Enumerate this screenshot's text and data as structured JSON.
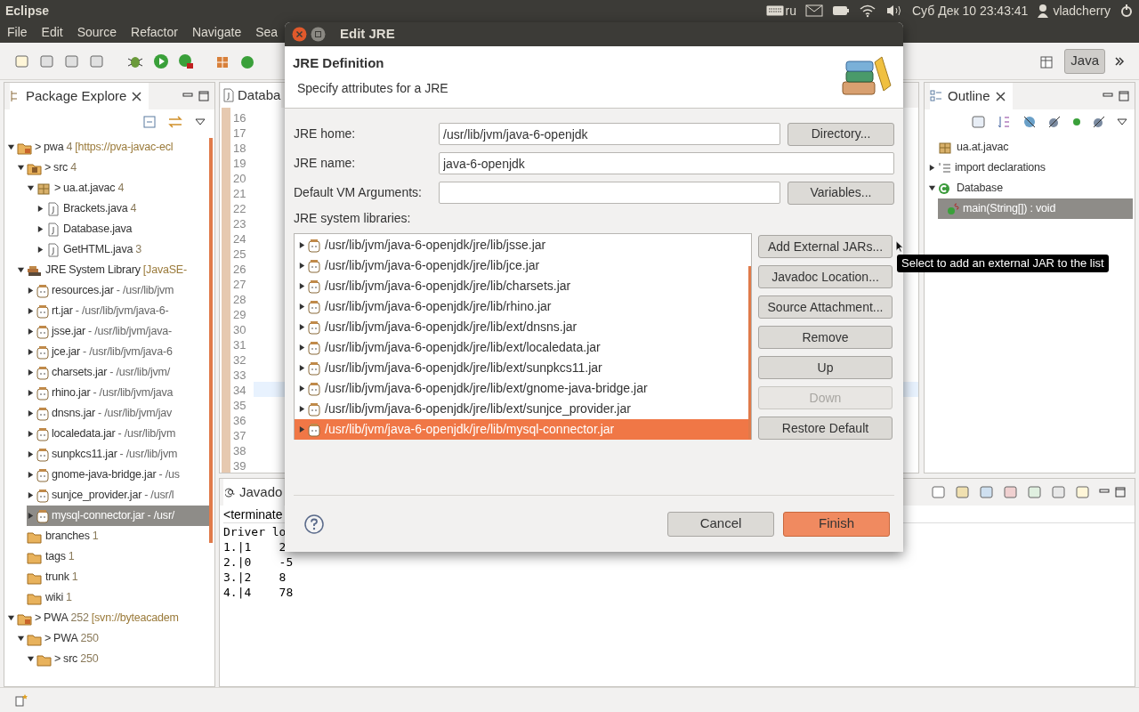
{
  "top_panel": {
    "app_title": "Eclipse",
    "keyboard_layout": "ru",
    "clock": "Суб Дек 10 23:43:41",
    "user": "vladcherry"
  },
  "menu": [
    "File",
    "Edit",
    "Source",
    "Refactor",
    "Navigate",
    "Sea"
  ],
  "perspective": {
    "label": "Java",
    "selected": true
  },
  "package_explorer": {
    "title": "Package Explore",
    "tree": [
      {
        "prefix": ">",
        "name": "pwa",
        "count": "4",
        "detail": "[https://pva-javac-ecl",
        "kind": "project",
        "expanded": true,
        "selected": false,
        "children": [
          {
            "prefix": ">",
            "name": "src",
            "count": "4",
            "kind": "source",
            "expanded": true,
            "selected": false,
            "children": [
              {
                "prefix": ">",
                "name": "ua.at.javac",
                "count": "4",
                "kind": "package",
                "expanded": true,
                "selected": false,
                "children": [
                  {
                    "name": "Brackets.java",
                    "count": "4",
                    "kind": "java",
                    "expanded": false,
                    "selected": false
                  },
                  {
                    "name": "Database.java",
                    "kind": "java",
                    "expanded": false,
                    "selected": false
                  },
                  {
                    "name": "GetHTML.java",
                    "count": "3",
                    "kind": "java",
                    "expanded": false,
                    "selected": false
                  }
                ]
              }
            ]
          },
          {
            "name": "JRE System Library",
            "detail": "[JavaSE-",
            "kind": "library",
            "expanded": true,
            "selected": false,
            "children": [
              {
                "name": "resources.jar",
                "detail": "- /usr/lib/jvm",
                "kind": "jar",
                "expanded": false,
                "selected": false
              },
              {
                "name": "rt.jar",
                "detail": "- /usr/lib/jvm/java-6-",
                "kind": "jar",
                "expanded": false,
                "selected": false
              },
              {
                "name": "jsse.jar",
                "detail": "- /usr/lib/jvm/java-",
                "kind": "jar",
                "expanded": false,
                "selected": false
              },
              {
                "name": "jce.jar",
                "detail": "- /usr/lib/jvm/java-6",
                "kind": "jar",
                "expanded": false,
                "selected": false
              },
              {
                "name": "charsets.jar",
                "detail": "- /usr/lib/jvm/",
                "kind": "jar",
                "expanded": false,
                "selected": false
              },
              {
                "name": "rhino.jar",
                "detail": "- /usr/lib/jvm/java",
                "kind": "jar",
                "expanded": false,
                "selected": false
              },
              {
                "name": "dnsns.jar",
                "detail": "- /usr/lib/jvm/jav",
                "kind": "jar",
                "expanded": false,
                "selected": false
              },
              {
                "name": "localedata.jar",
                "detail": "- /usr/lib/jvm",
                "kind": "jar",
                "expanded": false,
                "selected": false
              },
              {
                "name": "sunpkcs11.jar",
                "detail": "- /usr/lib/jvm",
                "kind": "jar",
                "expanded": false,
                "selected": false
              },
              {
                "name": "gnome-java-bridge.jar",
                "detail": "- /us",
                "kind": "jar",
                "expanded": false,
                "selected": false
              },
              {
                "name": "sunjce_provider.jar",
                "detail": "- /usr/l",
                "kind": "jar",
                "expanded": false,
                "selected": false
              },
              {
                "name": "mysql-connector.jar",
                "detail": "- /usr/",
                "kind": "jar",
                "expanded": false,
                "selected": true
              }
            ]
          },
          {
            "name": "branches",
            "count": "1",
            "kind": "folder",
            "selected": false
          },
          {
            "name": "tags",
            "count": "1",
            "kind": "folder",
            "selected": false
          },
          {
            "name": "trunk",
            "count": "1",
            "kind": "folder",
            "selected": false
          },
          {
            "name": "wiki",
            "count": "1",
            "kind": "folder",
            "selected": false
          }
        ]
      },
      {
        "prefix": ">",
        "name": "PWA",
        "count": "252",
        "detail": "[svn://byteacadem",
        "kind": "project",
        "expanded": true,
        "selected": false,
        "children": [
          {
            "prefix": ">",
            "name": "PWA",
            "count": "250",
            "kind": "folder",
            "expanded": true,
            "selected": false,
            "children": [
              {
                "prefix": ">",
                "name": "src",
                "count": "250",
                "kind": "folder",
                "expanded": true,
                "selected": false
              }
            ]
          }
        ]
      }
    ]
  },
  "editor": {
    "tab": "Databa",
    "lines": [
      {
        "number": "16",
        "current": false
      },
      {
        "number": "17",
        "current": false
      },
      {
        "number": "18",
        "current": false
      },
      {
        "number": "19",
        "current": false
      },
      {
        "number": "20",
        "current": false
      },
      {
        "number": "21",
        "current": false
      },
      {
        "number": "22",
        "current": false
      },
      {
        "number": "23",
        "current": false
      },
      {
        "number": "24",
        "current": false
      },
      {
        "number": "25",
        "current": false
      },
      {
        "number": "26",
        "current": false
      },
      {
        "number": "27",
        "current": false
      },
      {
        "number": "28",
        "current": false
      },
      {
        "number": "29",
        "current": false
      },
      {
        "number": "30",
        "current": false
      },
      {
        "number": "31",
        "current": false
      },
      {
        "number": "32",
        "current": false
      },
      {
        "number": "33",
        "current": false
      },
      {
        "number": "34",
        "current": true
      },
      {
        "number": "35",
        "current": false
      },
      {
        "number": "36",
        "current": false
      },
      {
        "number": "37",
        "current": false
      },
      {
        "number": "38",
        "current": false
      },
      {
        "number": "39",
        "current": false
      }
    ]
  },
  "console": {
    "tab": "Javado",
    "header": "<terminate",
    "lines": [
      "Driver lo",
      "1.|1    2",
      "2.|0    -5",
      "3.|2    8",
      "4.|4    78"
    ]
  },
  "outline": {
    "title": "Outline",
    "items": [
      {
        "name": "ua.at.javac",
        "kind": "package",
        "selected": false
      },
      {
        "name": "import declarations",
        "kind": "imports",
        "expanded": false,
        "selected": false
      },
      {
        "name": "Database",
        "kind": "class",
        "expanded": true,
        "selected": false,
        "children": [
          {
            "name": "main(String[]) : void",
            "kind": "method",
            "selected": true
          }
        ]
      }
    ]
  },
  "dialog": {
    "title": "Edit JRE",
    "header_title": "JRE Definition",
    "header_subtitle": "Specify attributes for a JRE",
    "fields": [
      {
        "label": "JRE home:",
        "value": "/usr/lib/jvm/java-6-openjdk",
        "button": "Directory..."
      },
      {
        "label": "JRE name:",
        "value": "java-6-openjdk"
      },
      {
        "label": "Default VM Arguments:",
        "button": "Variables..."
      }
    ],
    "libraries_label": "JRE system libraries:",
    "libraries": [
      {
        "path": "/usr/lib/jvm/java-6-openjdk/jre/lib/jsse.jar",
        "expanded": false,
        "selected": false
      },
      {
        "path": "/usr/lib/jvm/java-6-openjdk/jre/lib/jce.jar",
        "expanded": false,
        "selected": false
      },
      {
        "path": "/usr/lib/jvm/java-6-openjdk/jre/lib/charsets.jar",
        "expanded": false,
        "selected": false
      },
      {
        "path": "/usr/lib/jvm/java-6-openjdk/jre/lib/rhino.jar",
        "expanded": false,
        "selected": false
      },
      {
        "path": "/usr/lib/jvm/java-6-openjdk/jre/lib/ext/dnsns.jar",
        "expanded": false,
        "selected": false
      },
      {
        "path": "/usr/lib/jvm/java-6-openjdk/jre/lib/ext/localedata.jar",
        "expanded": false,
        "selected": false
      },
      {
        "path": "/usr/lib/jvm/java-6-openjdk/jre/lib/ext/sunpkcs11.jar",
        "expanded": false,
        "selected": false
      },
      {
        "path": "/usr/lib/jvm/java-6-openjdk/jre/lib/ext/gnome-java-bridge.jar",
        "expanded": false,
        "selected": false
      },
      {
        "path": "/usr/lib/jvm/java-6-openjdk/jre/lib/ext/sunjce_provider.jar",
        "expanded": false,
        "selected": false
      },
      {
        "path": "/usr/lib/jvm/java-6-openjdk/jre/lib/mysql-connector.jar",
        "expanded": false,
        "selected": true
      }
    ],
    "side_buttons": [
      {
        "label": "Add External JARs...",
        "disabled": false
      },
      {
        "label": "Javadoc Location...",
        "disabled": false
      },
      {
        "label": "Source Attachment...",
        "disabled": false
      },
      {
        "label": "Remove",
        "disabled": false
      },
      {
        "label": "Up",
        "disabled": false
      },
      {
        "label": "Down",
        "disabled": true
      },
      {
        "label": "Restore Default",
        "disabled": false
      }
    ],
    "tooltip": "Select to add an external JAR to the list",
    "footer_buttons": [
      {
        "label": "Cancel",
        "kind": "default"
      },
      {
        "label": "Finish",
        "kind": "primary"
      }
    ]
  }
}
